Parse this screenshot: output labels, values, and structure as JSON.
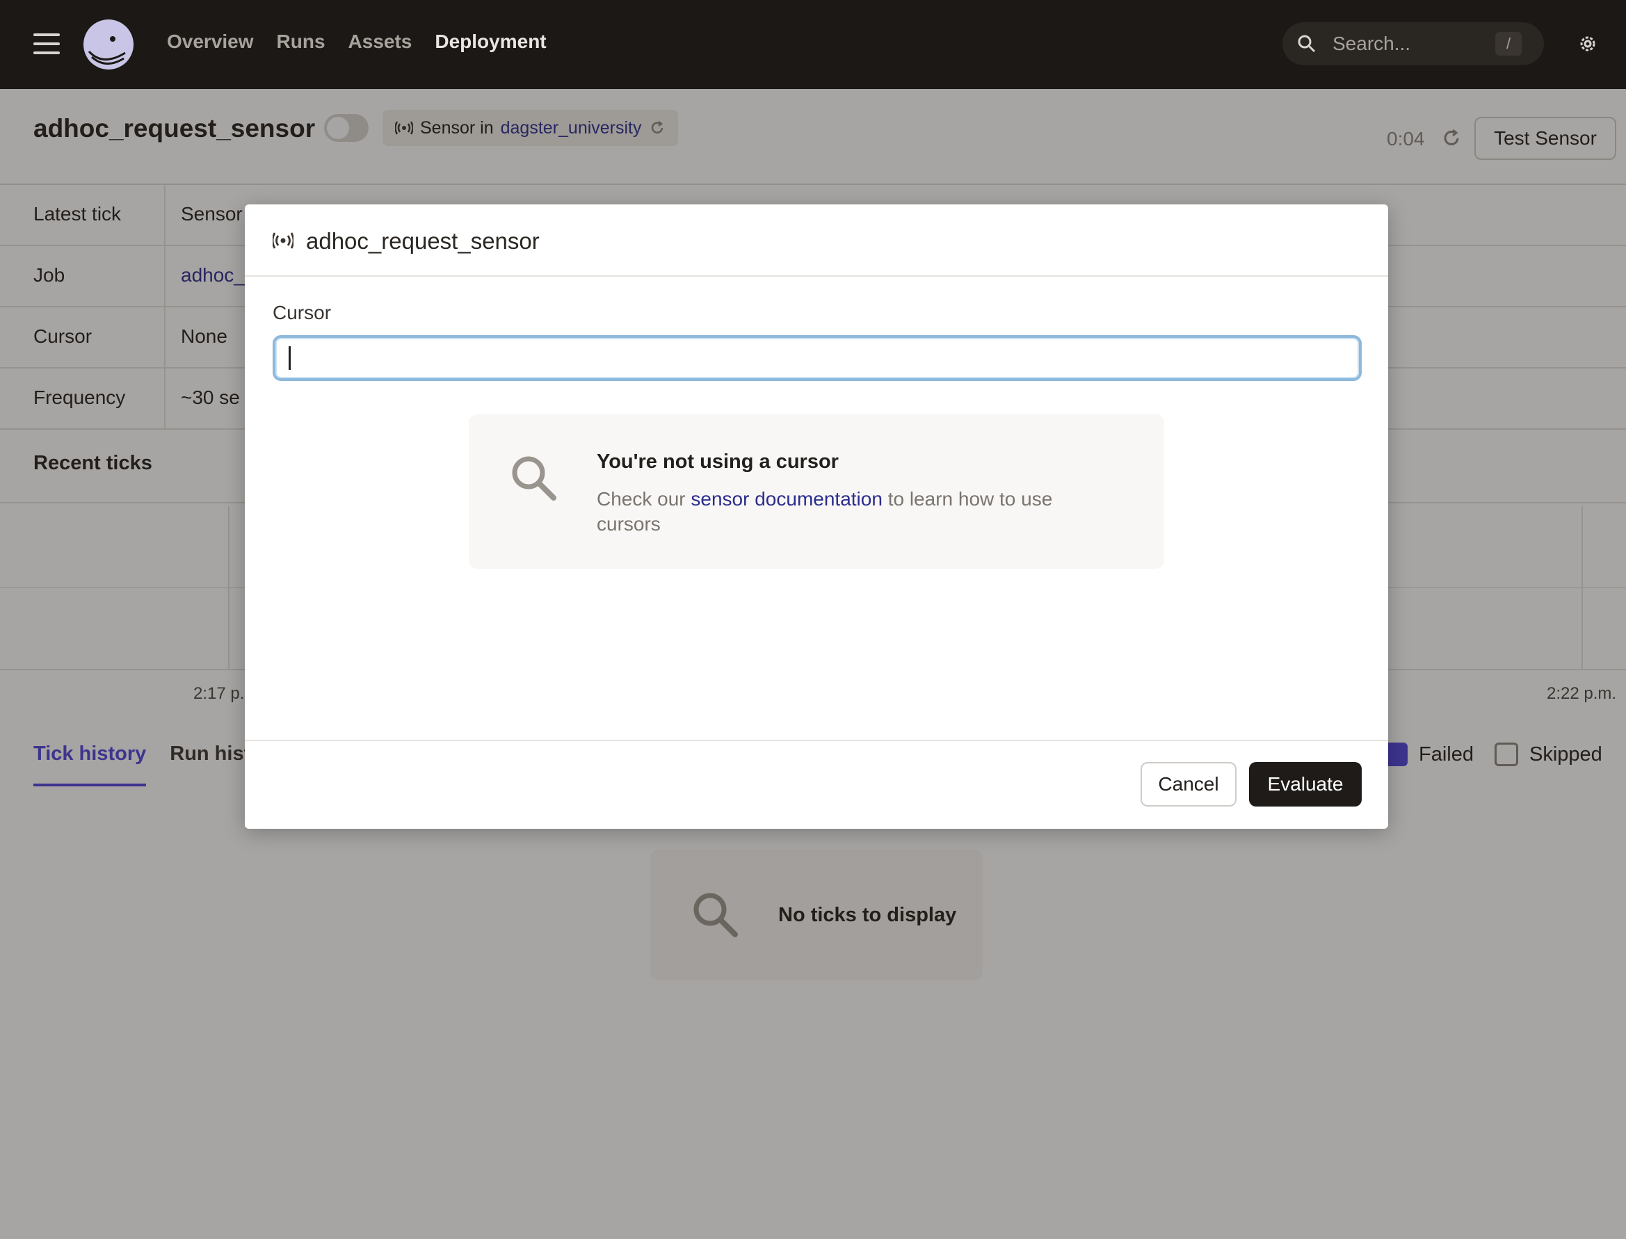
{
  "topbar": {
    "nav": [
      "Overview",
      "Runs",
      "Assets",
      "Deployment"
    ],
    "active_nav": "Deployment",
    "search": {
      "placeholder": "Search...",
      "shortcut": "/"
    },
    "icons": {
      "menu": "hamburger-icon",
      "logo": "dagster-logo",
      "search": "search-icon",
      "settings": "gear-icon"
    }
  },
  "header": {
    "title": "adhoc_request_sensor",
    "sensor_prefix": "Sensor in",
    "location": "dagster_university",
    "timer": "0:04",
    "test_button": "Test Sensor"
  },
  "properties": [
    {
      "label": "Latest tick",
      "value": "Sensor"
    },
    {
      "label": "Job",
      "value": "adhoc_"
    },
    {
      "label": "Cursor",
      "value": "None"
    },
    {
      "label": "Frequency",
      "value": "~30 se"
    }
  ],
  "recent_ticks": {
    "title": "Recent ticks",
    "axis_labels": [
      "2:17 p.",
      "2:22 p.m."
    ]
  },
  "tabs": {
    "items": [
      "Tick history",
      "Run histo"
    ],
    "active": "Tick history"
  },
  "filters": [
    {
      "label": "Failed",
      "checked": true
    },
    {
      "label": "Skipped",
      "checked": false
    }
  ],
  "empty_ticks": {
    "message": "No ticks to display"
  },
  "dialog": {
    "title": "adhoc_request_sensor",
    "cursor_label": "Cursor",
    "cursor_value": "",
    "empty_title": "You're not using a cursor",
    "empty_desc_before": "Check our",
    "empty_desc_link": "sensor documentation",
    "empty_desc_after": "to learn how to use cursors",
    "cancel": "Cancel",
    "evaluate": "Evaluate"
  },
  "colors": {
    "topbar": "#1b1815",
    "accent": "#4f43dd",
    "link": "#2b2c8f",
    "focus": "#8db9dc"
  }
}
